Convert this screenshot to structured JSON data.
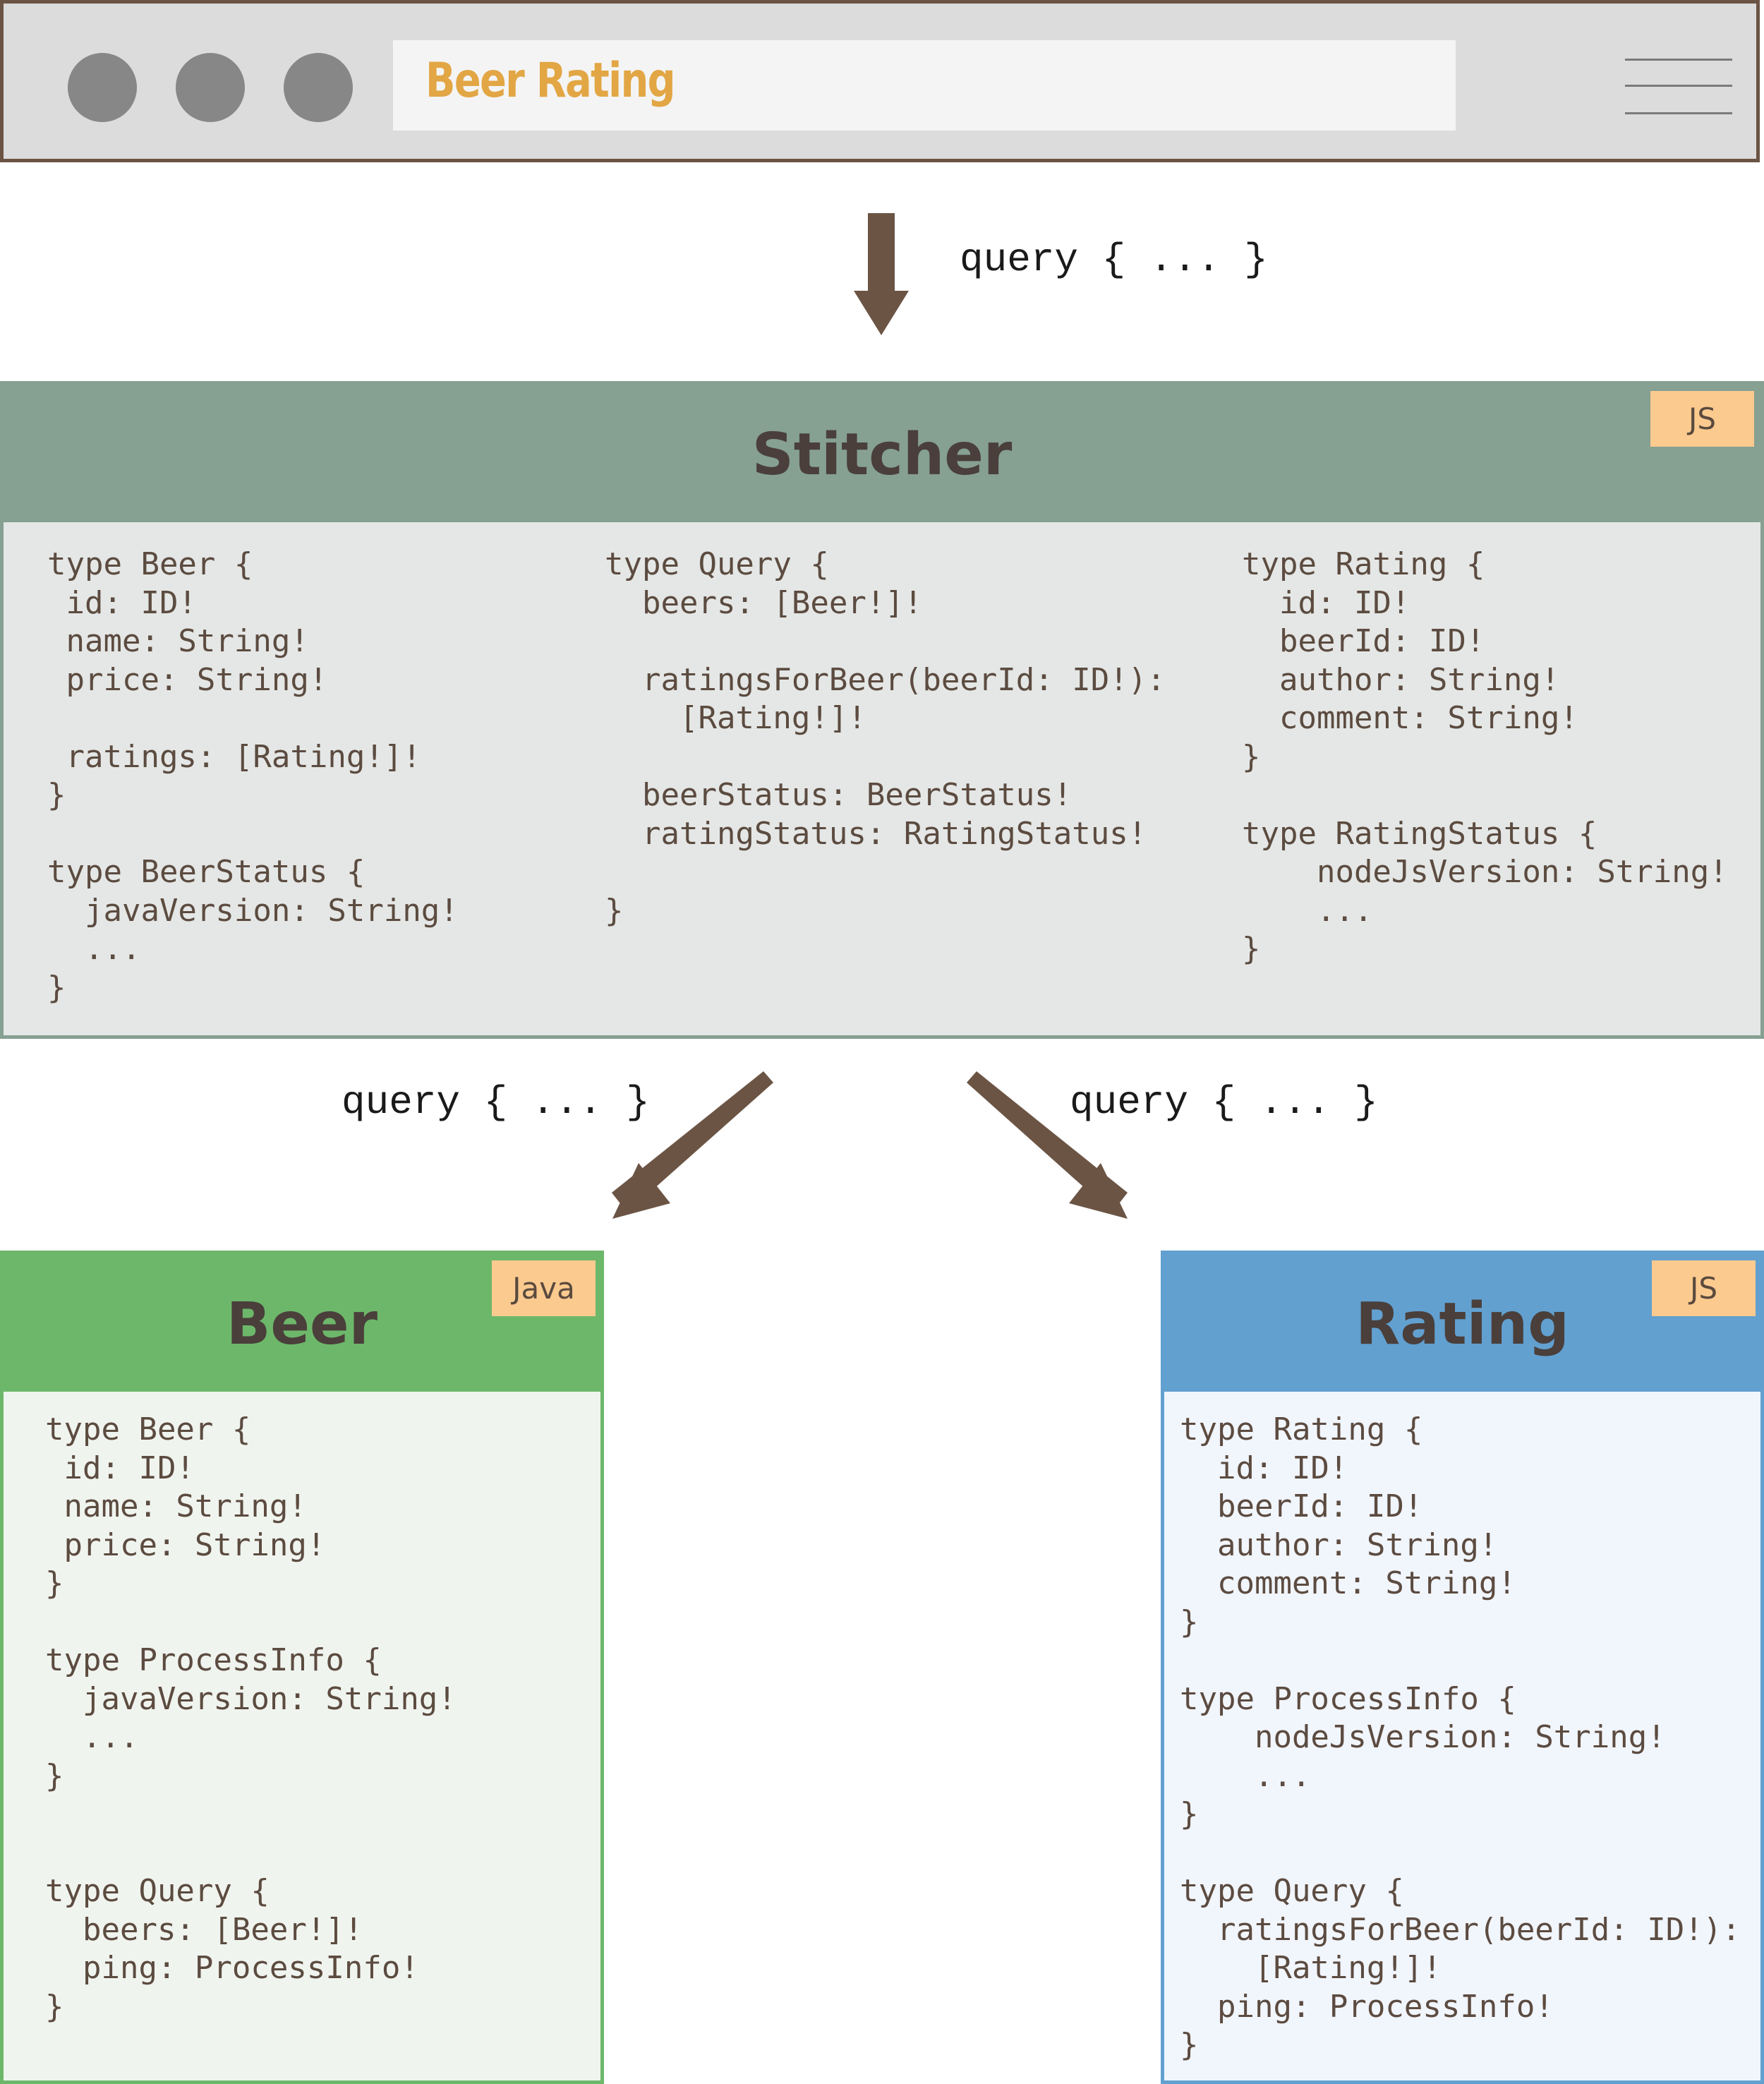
{
  "browser": {
    "title": "Beer Rating",
    "menu_icon": "hamburger-menu-icon"
  },
  "queries": {
    "client_to_stitcher": "query { ... }",
    "stitcher_to_beer": "query { ... }",
    "stitcher_to_rating": "query { ... }"
  },
  "stitcher": {
    "title": "Stitcher",
    "tag": "JS",
    "schema_col1": "type Beer {\n id: ID!\n name: String!\n price: String!\n\n ratings: [Rating!]!\n}\n\ntype BeerStatus {\n  javaVersion: String!\n  ...\n}",
    "schema_col2": "type Query {\n  beers: [Beer!]!\n\n  ratingsForBeer(beerId: ID!):\n    [Rating!]!\n\n  beerStatus: BeerStatus!\n  ratingStatus: RatingStatus!\n\n}",
    "schema_col3": "type Rating {\n  id: ID!\n  beerId: ID!\n  author: String!\n  comment: String!\n}\n\ntype RatingStatus {\n    nodeJsVersion: String!\n    ...\n}"
  },
  "beer_service": {
    "title": "Beer",
    "tag": "Java",
    "schema": "type Beer {\n id: ID!\n name: String!\n price: String!\n}\n\ntype ProcessInfo {\n  javaVersion: String!\n  ...\n}\n\n\ntype Query {\n  beers: [Beer!]!\n  ping: ProcessInfo!\n}"
  },
  "rating_service": {
    "title": "Rating",
    "tag": "JS",
    "schema": "type Rating {\n  id: ID!\n  beerId: ID!\n  author: String!\n  comment: String!\n}\n\ntype ProcessInfo {\n    nodeJsVersion: String!\n    ...\n}\n\ntype Query {\n  ratingsForBeer(beerId: ID!):\n    [Rating!]!\n  ping: ProcessInfo!\n}"
  },
  "colors": {
    "arrow": "#6b5444",
    "stitcher_header": "#86a092",
    "beer_header": "#6db76a",
    "rating_header": "#62a0d0",
    "tag_bg": "#fbca8f",
    "browser_title": "#e2a644"
  }
}
